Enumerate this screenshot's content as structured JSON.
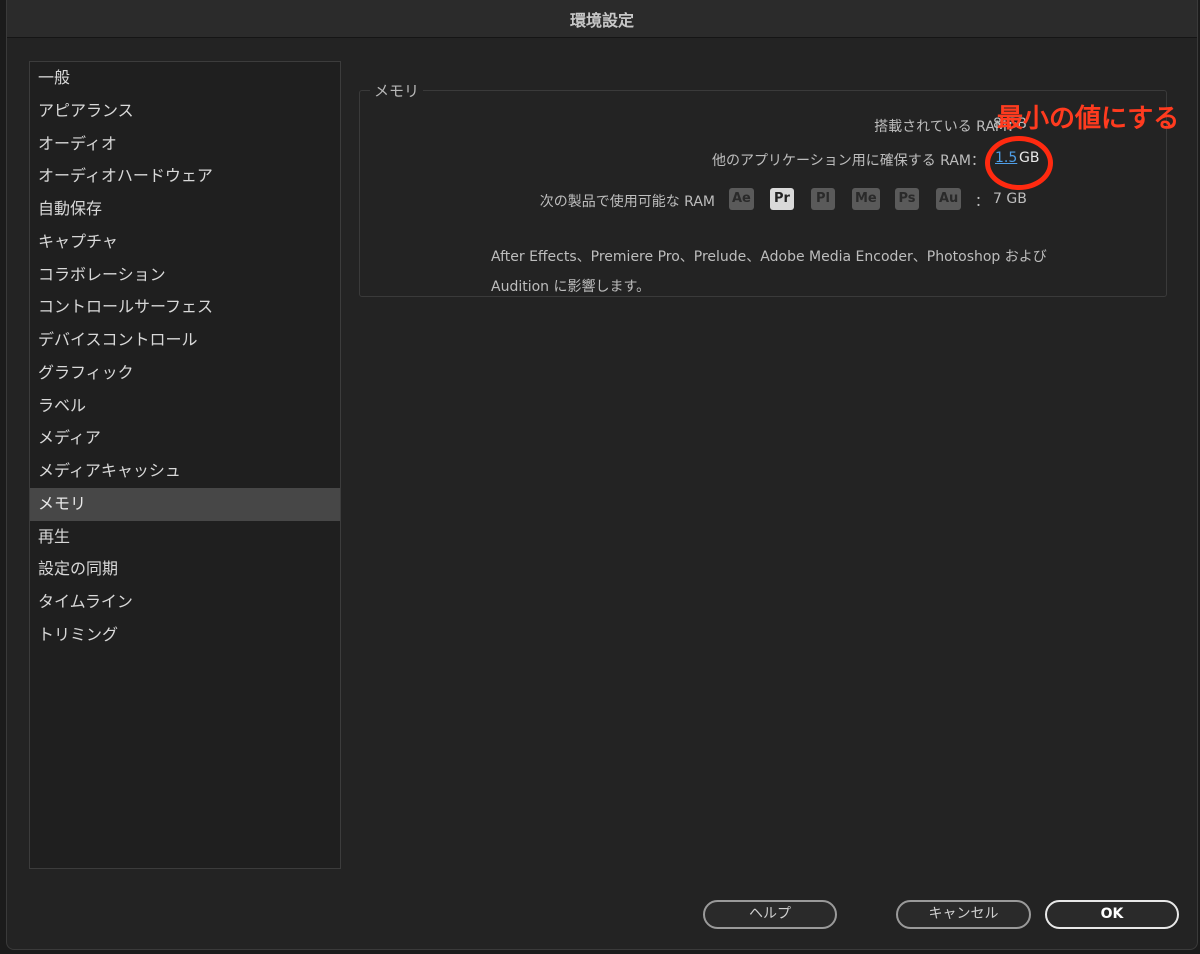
{
  "window": {
    "title": "環境設定"
  },
  "sidebar": {
    "items": [
      {
        "label": "一般"
      },
      {
        "label": "アピアランス"
      },
      {
        "label": "オーディオ"
      },
      {
        "label": "オーディオハードウェア"
      },
      {
        "label": "自動保存"
      },
      {
        "label": "キャプチャ"
      },
      {
        "label": "コラボレーション"
      },
      {
        "label": "コントロールサーフェス"
      },
      {
        "label": "デバイスコントロール"
      },
      {
        "label": "グラフィック"
      },
      {
        "label": "ラベル"
      },
      {
        "label": "メディア"
      },
      {
        "label": "メディアキャッシュ"
      },
      {
        "label": "メモリ"
      },
      {
        "label": "再生"
      },
      {
        "label": "設定の同期"
      },
      {
        "label": "タイムライン"
      },
      {
        "label": "トリミング"
      }
    ],
    "selected": "メモリ"
  },
  "memory": {
    "group_title": "メモリ",
    "installed_label": "搭載されている RAM：",
    "installed_value": "8 GB",
    "reserve_label": "他のアプリケーション用に確保する RAM：",
    "reserve_value": "1.5",
    "reserve_unit": "GB",
    "available_label": "次の製品で使用可能な RAM",
    "available_sep": "：",
    "available_value": "7 GB",
    "apps": [
      {
        "abbr": "Ae",
        "active": false
      },
      {
        "abbr": "Pr",
        "active": true
      },
      {
        "abbr": "Pl",
        "active": false
      },
      {
        "abbr": "Me",
        "active": false
      },
      {
        "abbr": "Ps",
        "active": false
      },
      {
        "abbr": "Au",
        "active": false
      }
    ],
    "description_line1": "After Effects、Premiere Pro、Prelude、Adobe Media Encoder、Photoshop および",
    "description_line2": "Audition に影響します。"
  },
  "annotation": {
    "text": "最小の値にする",
    "color": "#ff3b1f"
  },
  "buttons": {
    "help": "ヘルプ",
    "cancel": "キャンセル",
    "ok": "OK"
  }
}
